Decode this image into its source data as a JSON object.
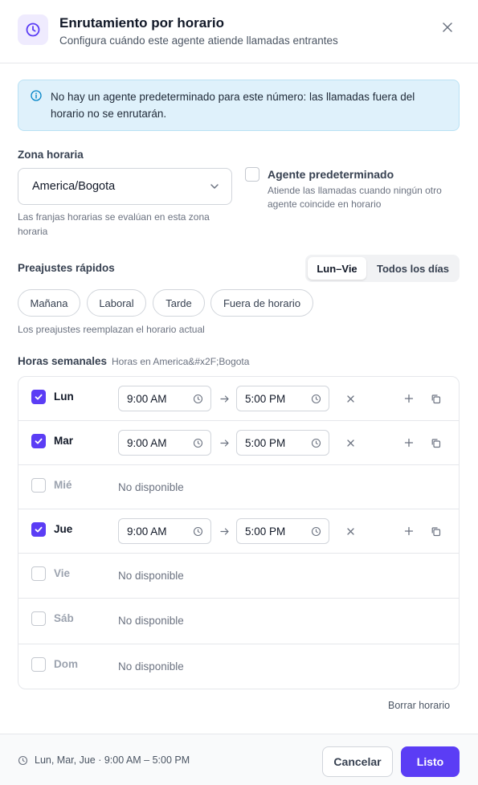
{
  "header": {
    "title": "Enrutamiento por horario",
    "subtitle": "Configura cuándo este agente atiende llamadas entrantes",
    "icon": "clock-icon",
    "close_icon": "close-icon"
  },
  "info": {
    "text": "No hay un agente predeterminado para este número: las llamadas fuera del horario no se enrutarán.",
    "icon": "info-icon"
  },
  "timezone": {
    "label": "Zona horaria",
    "value": "America/Bogota",
    "hint": "Las franjas horarias se evalúan en esta zona horaria"
  },
  "default_agent": {
    "checked": false,
    "title": "Agente predeterminado",
    "description": "Atiende las llamadas cuando ningún otro agente coincide en horario"
  },
  "presets": {
    "label": "Preajustes rápidos",
    "segments": [
      {
        "label": "Lun–Vie",
        "active": true
      },
      {
        "label": "Todos los días",
        "active": false
      }
    ],
    "chips": [
      "Mañana",
      "Laboral",
      "Tarde",
      "Fuera de horario"
    ],
    "hint": "Los preajustes reemplazan el horario actual"
  },
  "weekly": {
    "label": "Horas semanales",
    "subtitle": "Horas en America&#x2F;Bogota",
    "unavailable_text": "No disponible",
    "days": [
      {
        "name": "Lun",
        "enabled": true,
        "start": "9:00 AM",
        "end": "5:00 PM"
      },
      {
        "name": "Mar",
        "enabled": true,
        "start": "9:00 AM",
        "end": "5:00 PM"
      },
      {
        "name": "Mié",
        "enabled": false,
        "status": "No disponible"
      },
      {
        "name": "Jue",
        "enabled": true,
        "start": "9:00 AM",
        "end": "5:00 PM"
      },
      {
        "name": "Vie",
        "enabled": false,
        "status": "No disponible"
      },
      {
        "name": "Sáb",
        "enabled": false,
        "status": "No disponible"
      },
      {
        "name": "Dom",
        "enabled": false,
        "status": "No disponible"
      }
    ]
  },
  "clear_label": "Borrar horario",
  "footer": {
    "summary": "Lun, Mar, Jue · 9:00 AM – 5:00 PM",
    "cancel_label": "Cancelar",
    "done_label": "Listo"
  },
  "colors": {
    "accent": "#5b3df5",
    "info_bg": "#dff1fb"
  }
}
